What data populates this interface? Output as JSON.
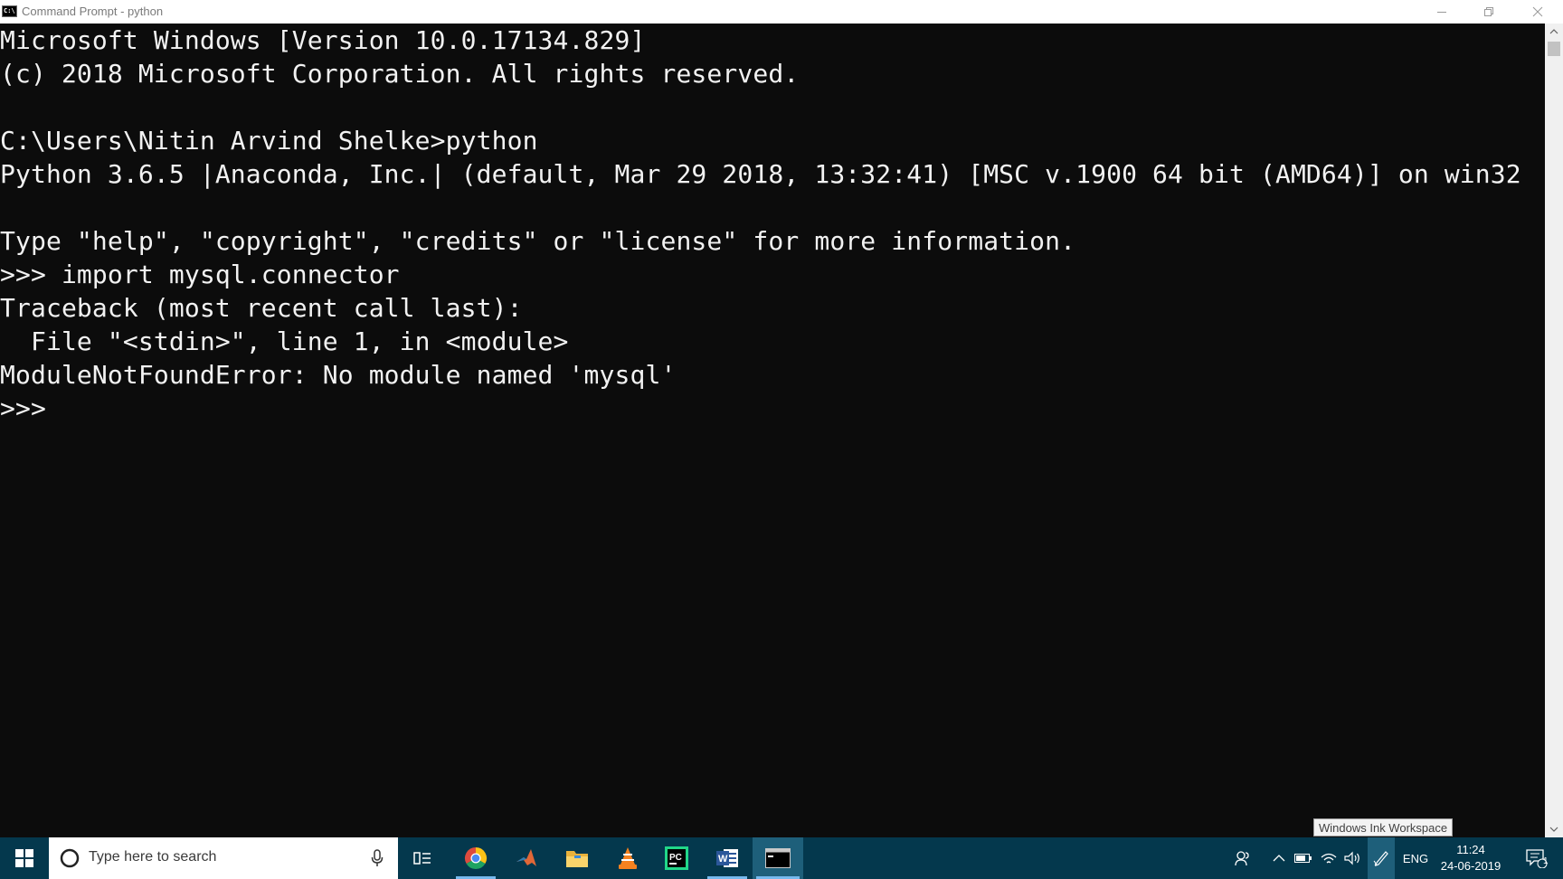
{
  "window": {
    "title": "Command Prompt - python",
    "app_icon_text": "C:\\"
  },
  "console": {
    "lines": [
      "Microsoft Windows [Version 10.0.17134.829]",
      "(c) 2018 Microsoft Corporation. All rights reserved.",
      "",
      "C:\\Users\\Nitin Arvind Shelke>python",
      "Python 3.6.5 |Anaconda, Inc.| (default, Mar 29 2018, 13:32:41) [MSC v.1900 64 bit (AMD64)] on win32",
      "",
      "Type \"help\", \"copyright\", \"credits\" or \"license\" for more information.",
      ">>> import mysql.connector",
      "Traceback (most recent call last):",
      "  File \"<stdin>\", line 1, in <module>",
      "ModuleNotFoundError: No module named 'mysql'",
      ">>> "
    ]
  },
  "tooltip": "Windows Ink Workspace",
  "taskbar": {
    "search_placeholder": "Type here to search",
    "pinned": [
      "start-icon",
      "task-view-icon",
      "chrome-icon",
      "matlab-icon",
      "file-explorer-icon",
      "vlc-icon",
      "pycharm-icon",
      "word-icon",
      "command-prompt-icon"
    ],
    "pycharm_label": "PC",
    "word_label": "W",
    "tray": {
      "language": "ENG",
      "time": "11:24",
      "date": "24-06-2019",
      "notification_count": "1"
    }
  },
  "colors": {
    "console_bg": "#0c0c0c",
    "console_text": "#f2f2f2",
    "taskbar_bg": "#04384d",
    "active_indicator": "#76b9ed"
  }
}
